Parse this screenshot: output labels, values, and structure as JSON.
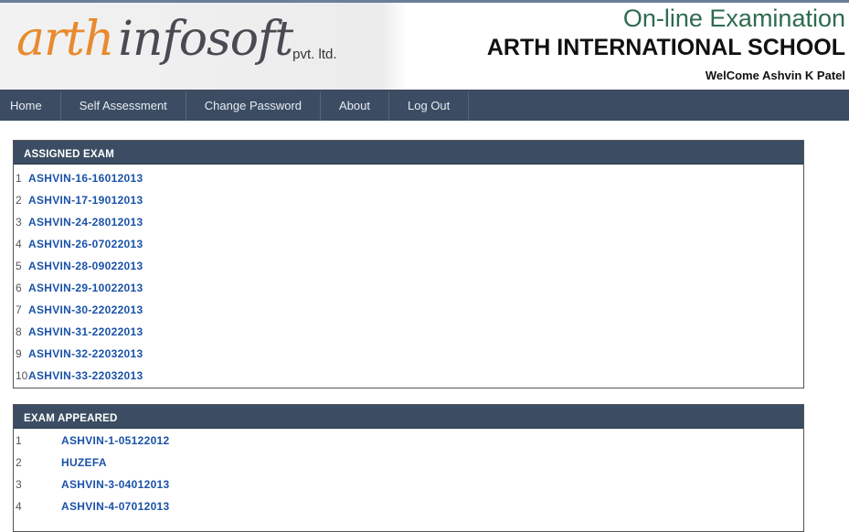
{
  "header": {
    "logo_part1": "arth",
    "logo_part2": "infosoft",
    "logo_suffix": "pvt. ltd.",
    "app_title": "On-line Examination",
    "school_name": "ARTH INTERNATIONAL SCHOOL",
    "welcome": "WelCome Ashvin K Patel"
  },
  "nav": {
    "items": [
      {
        "label": "Home"
      },
      {
        "label": "Self Assessment"
      },
      {
        "label": "Change Password"
      },
      {
        "label": "About"
      },
      {
        "label": "Log Out"
      }
    ]
  },
  "assigned": {
    "title": "ASSIGNED EXAM",
    "items": [
      {
        "num": "1",
        "name": "ASHVIN-16-16012013"
      },
      {
        "num": "2",
        "name": "ASHVIN-17-19012013"
      },
      {
        "num": "3",
        "name": "ASHVIN-24-28012013"
      },
      {
        "num": "4",
        "name": "ASHVIN-26-07022013"
      },
      {
        "num": "5",
        "name": "ASHVIN-28-09022013"
      },
      {
        "num": "6",
        "name": "ASHVIN-29-10022013"
      },
      {
        "num": "7",
        "name": "ASHVIN-30-22022013"
      },
      {
        "num": "8",
        "name": "ASHVIN-31-22022013"
      },
      {
        "num": "9",
        "name": "ASHVIN-32-22032013"
      },
      {
        "num": "10",
        "name": "ASHVIN-33-22032013"
      }
    ]
  },
  "appeared": {
    "title": "EXAM APPEARED",
    "items": [
      {
        "num": "1",
        "name": "ASHVIN-1-05122012"
      },
      {
        "num": "2",
        "name": "HUZEFA"
      },
      {
        "num": "3",
        "name": "ASHVIN-3-04012013"
      },
      {
        "num": "4",
        "name": "ASHVIN-4-07012013"
      }
    ]
  },
  "colors": {
    "nav_bg": "#3c4d63",
    "link": "#1a52a8",
    "logo_orange": "#e88a2e",
    "title_green": "#2e6b4e"
  }
}
